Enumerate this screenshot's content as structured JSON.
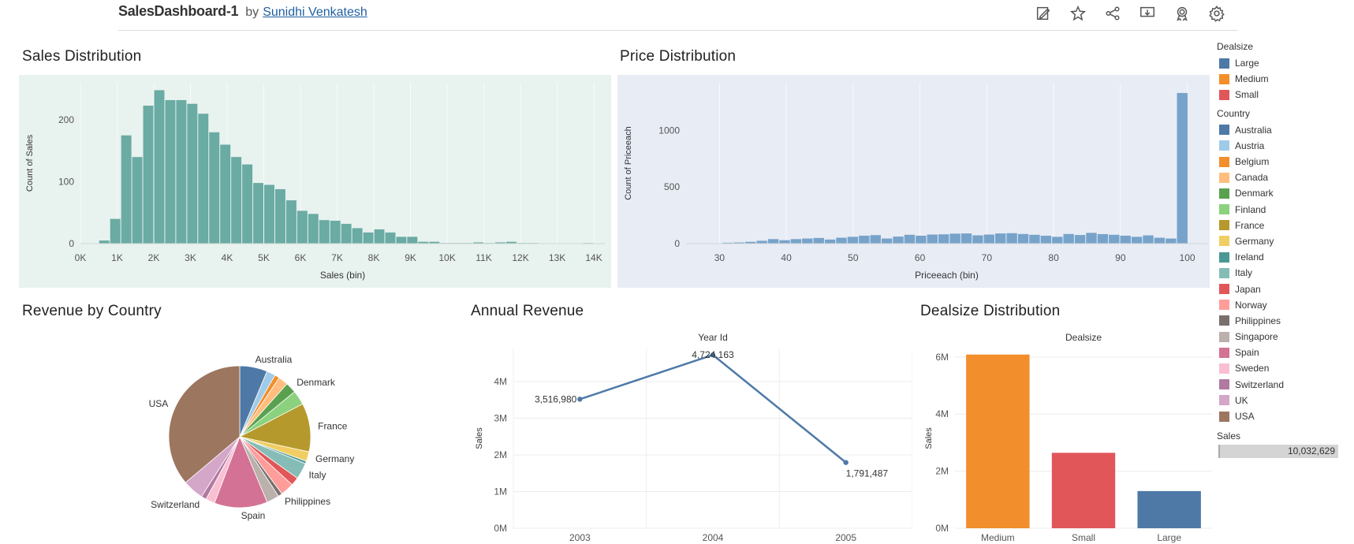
{
  "header": {
    "dashboard_title": "SalesDashboard-1",
    "by_label": "by",
    "author": "Sunidhi Venkatesh",
    "icons": [
      "edit-icon",
      "star-icon",
      "share-icon",
      "download-icon",
      "badge-icon",
      "gear-icon"
    ]
  },
  "colors": {
    "hist_sales_bg": "#e8f2ef",
    "hist_sales_bar": "#6aaba3",
    "hist_price_bg": "#e8ecf5",
    "hist_price_bar": "#77a3ca",
    "line": "#4e79a7"
  },
  "panels": {
    "sales_distribution": "Sales Distribution",
    "price_distribution": "Price Distribution",
    "revenue_by_country": "Revenue by Country",
    "annual_revenue": "Annual Revenue",
    "dealsize_distribution": "Dealsize Distribution"
  },
  "legend": {
    "dealsize_title": "Dealsize",
    "dealsize": [
      {
        "label": "Large",
        "color": "#4e79a7"
      },
      {
        "label": "Medium",
        "color": "#f28e2b"
      },
      {
        "label": "Small",
        "color": "#e15759"
      }
    ],
    "country_title": "Country",
    "countries": [
      {
        "label": "Australia",
        "color": "#4e79a7"
      },
      {
        "label": "Austria",
        "color": "#a0cbe8"
      },
      {
        "label": "Belgium",
        "color": "#f28e2b"
      },
      {
        "label": "Canada",
        "color": "#ffbe7d"
      },
      {
        "label": "Denmark",
        "color": "#59a14f"
      },
      {
        "label": "Finland",
        "color": "#8cd17d"
      },
      {
        "label": "France",
        "color": "#b6992d"
      },
      {
        "label": "Germany",
        "color": "#f1ce63"
      },
      {
        "label": "Ireland",
        "color": "#499894"
      },
      {
        "label": "Italy",
        "color": "#86bcb6"
      },
      {
        "label": "Japan",
        "color": "#e15759"
      },
      {
        "label": "Norway",
        "color": "#ff9d9a"
      },
      {
        "label": "Philippines",
        "color": "#79706e"
      },
      {
        "label": "Singapore",
        "color": "#bab0ac"
      },
      {
        "label": "Spain",
        "color": "#d37295"
      },
      {
        "label": "Sweden",
        "color": "#fabfd2"
      },
      {
        "label": "Switzerland",
        "color": "#b07aa1"
      },
      {
        "label": "UK",
        "color": "#d4a6c8"
      },
      {
        "label": "USA",
        "color": "#9d7660"
      }
    ],
    "sales_title": "Sales",
    "sales_value": "10,032,629"
  },
  "chart_data": [
    {
      "id": "sales_hist",
      "type": "bar",
      "title": "Sales Distribution",
      "xlabel": "Sales (bin)",
      "ylabel": "Count of Sales",
      "x_ticks": [
        "0K",
        "1K",
        "2K",
        "3K",
        "4K",
        "5K",
        "6K",
        "7K",
        "8K",
        "9K",
        "10K",
        "11K",
        "12K",
        "13K",
        "14K"
      ],
      "x": [
        500,
        800,
        1100,
        1400,
        1700,
        2000,
        2300,
        2600,
        2900,
        3200,
        3500,
        3800,
        4100,
        4400,
        4700,
        5000,
        5300,
        5600,
        5900,
        6200,
        6500,
        6800,
        7100,
        7400,
        7700,
        8000,
        8300,
        8600,
        8900,
        9200,
        9500,
        9800,
        10100,
        10400,
        10700,
        11000,
        11300,
        11600,
        11900,
        12200,
        12500,
        12800,
        13100,
        13400,
        13700,
        14000
      ],
      "values": [
        5,
        40,
        175,
        140,
        223,
        248,
        232,
        232,
        226,
        210,
        180,
        160,
        140,
        128,
        98,
        95,
        88,
        70,
        53,
        48,
        38,
        37,
        32,
        25,
        18,
        23,
        18,
        11,
        11,
        3,
        3,
        1,
        1,
        1,
        2,
        1,
        2,
        3,
        1,
        1,
        0,
        0,
        0,
        0,
        1,
        0
      ],
      "ylim": [
        0,
        260
      ],
      "y_ticks": [
        0,
        100,
        200
      ],
      "x_bin_width": 300
    },
    {
      "id": "price_hist",
      "type": "bar",
      "title": "Price Distribution",
      "xlabel": "Priceeach (bin)",
      "ylabel": "Count of Priceeach",
      "x_ticks": [
        30,
        40,
        50,
        60,
        70,
        80,
        90,
        100
      ],
      "x": [
        27,
        28.7,
        30.4,
        32.1,
        33.8,
        35.5,
        37.2,
        38.9,
        40.6,
        42.3,
        44,
        45.7,
        47.4,
        49.1,
        50.8,
        52.5,
        54.2,
        55.9,
        57.6,
        59.3,
        61,
        62.7,
        64.4,
        66.1,
        67.8,
        69.5,
        71.2,
        72.9,
        74.6,
        76.3,
        78,
        79.7,
        81.4,
        83.1,
        84.8,
        86.5,
        88.2,
        89.9,
        91.6,
        93.3,
        95,
        96.7,
        98.4,
        100.1
      ],
      "values": [
        0,
        0,
        8,
        10,
        16,
        25,
        40,
        30,
        40,
        45,
        50,
        36,
        52,
        60,
        70,
        75,
        45,
        62,
        78,
        70,
        80,
        82,
        88,
        90,
        73,
        80,
        90,
        92,
        85,
        78,
        70,
        60,
        85,
        76,
        95,
        84,
        78,
        70,
        60,
        73,
        52,
        45,
        1330,
        0
      ],
      "ylim": [
        0,
        1420
      ],
      "y_ticks": [
        0,
        500,
        1000
      ],
      "x_bin_width": 1.7
    },
    {
      "id": "country_pie",
      "type": "pie",
      "title": "Revenue by Country",
      "labels": [
        "Australia",
        "Austria",
        "Belgium",
        "Canada",
        "Denmark",
        "Finland",
        "France",
        "Germany",
        "Ireland",
        "Italy",
        "Japan",
        "Norway",
        "Philippines",
        "Singapore",
        "Spain",
        "Sweden",
        "Switzerland",
        "UK",
        "USA"
      ],
      "values": [
        630480,
        202063,
        108413,
        224079,
        245638,
        329582,
        1110917,
        220472,
        57756,
        374675,
        188168,
        307464,
        94016,
        288488,
        1215686,
        210014,
        117714,
        478880,
        3627983
      ],
      "slice_labels": [
        "Australia",
        "Denmark",
        "France",
        "Germany",
        "Italy",
        "Philippines",
        "Spain",
        "Switzerland",
        "USA"
      ]
    },
    {
      "id": "annual_line",
      "type": "line",
      "title": "Year Id",
      "xlabel": "",
      "ylabel": "Sales",
      "x": [
        "2003",
        "2004",
        "2005"
      ],
      "values": [
        3516980,
        4724163,
        1791487
      ],
      "data_labels": [
        "3,516,980",
        "4,724,163",
        "1,791,487"
      ],
      "ylim": [
        0,
        4900000
      ],
      "y_ticks": [
        0,
        1000000,
        2000000,
        3000000,
        4000000
      ],
      "y_tick_labels": [
        "0M",
        "1M",
        "2M",
        "3M",
        "4M"
      ]
    },
    {
      "id": "dealsize_bar",
      "type": "bar",
      "title": "Dealsize",
      "xlabel": "",
      "ylabel": "Sales",
      "categories": [
        "Medium",
        "Small",
        "Large"
      ],
      "values": [
        6087432,
        2643077,
        1302120
      ],
      "colors": [
        "#f28e2b",
        "#e15759",
        "#4e79a7"
      ],
      "ylim": [
        0,
        6300000
      ],
      "y_ticks": [
        0,
        2000000,
        4000000,
        6000000
      ],
      "y_tick_labels": [
        "0M",
        "2M",
        "4M",
        "6M"
      ]
    }
  ]
}
